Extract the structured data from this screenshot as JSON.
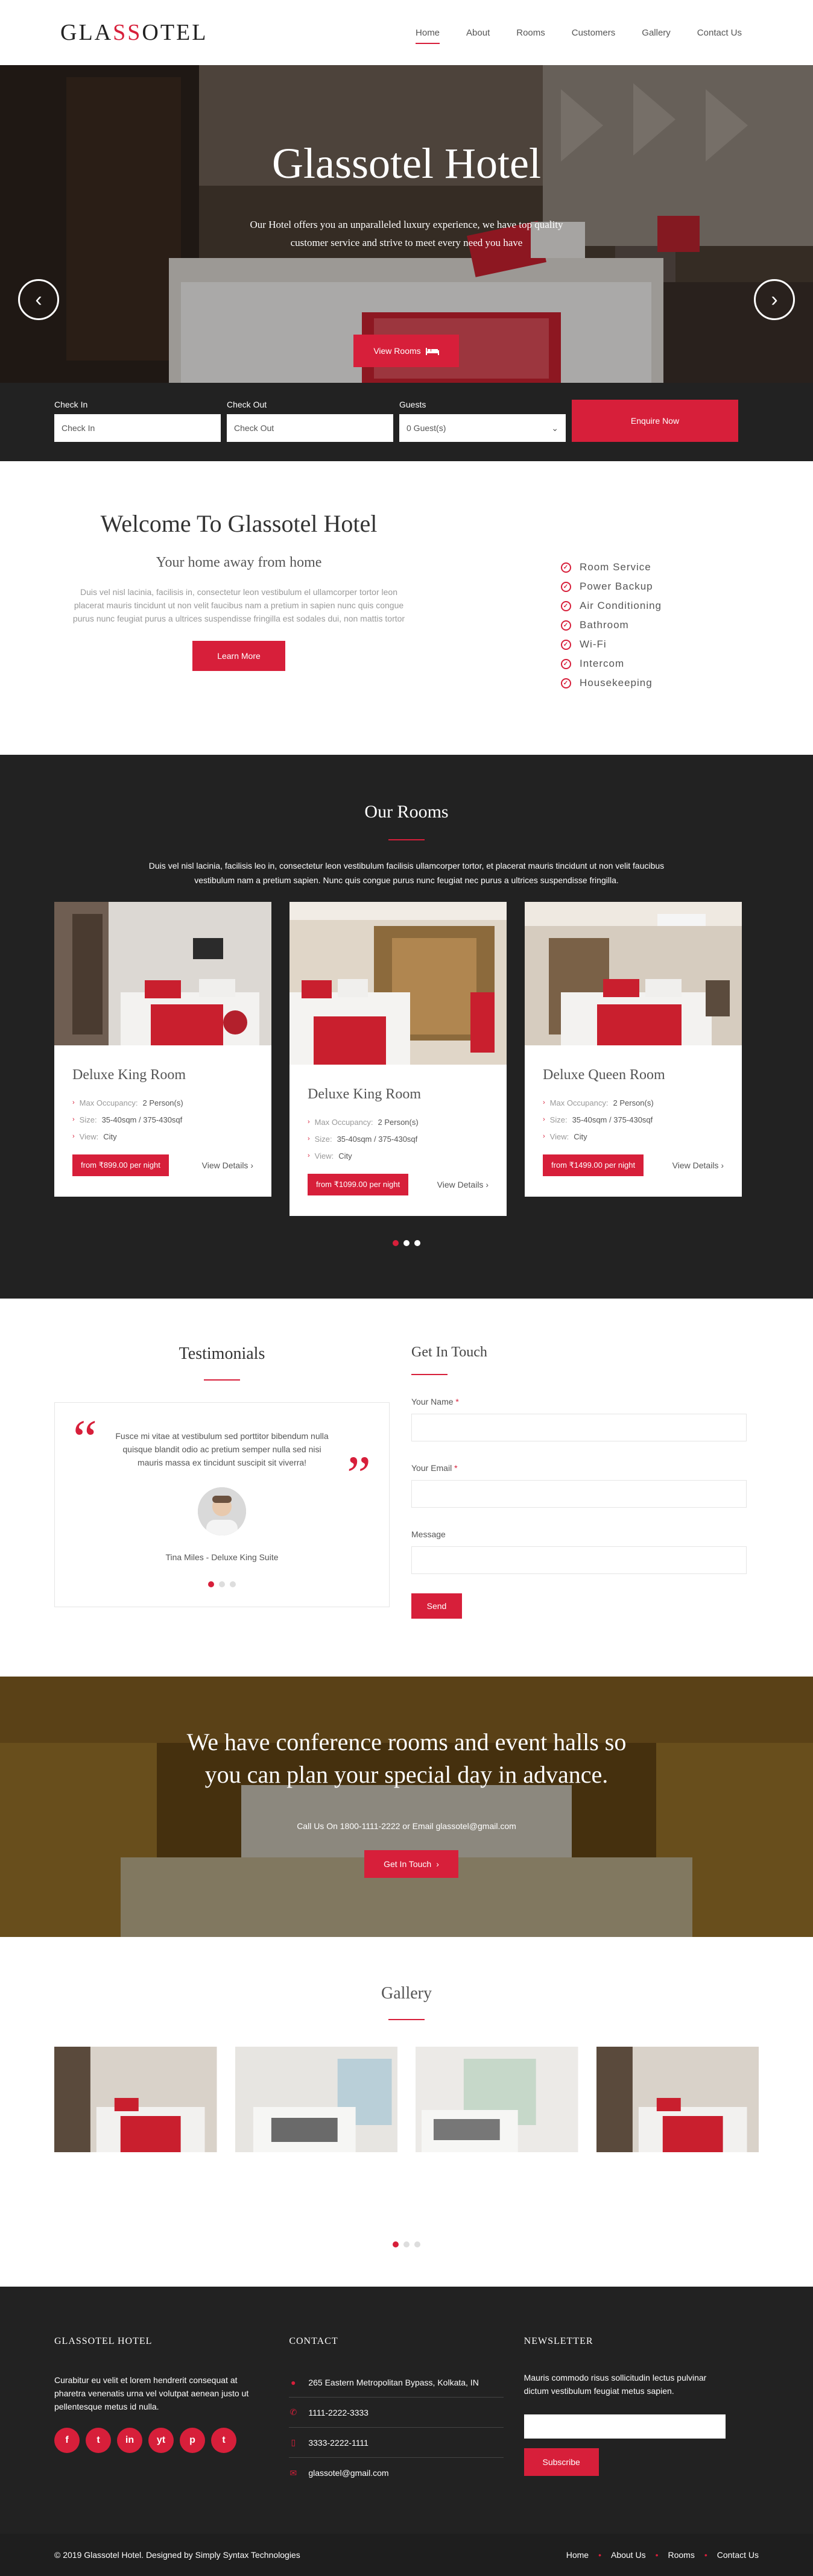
{
  "header": {
    "logo_left": "GLA",
    "logo_mid": "SS",
    "logo_right": "OTEL",
    "nav": [
      "Home",
      "About",
      "Rooms",
      "Customers",
      "Gallery",
      "Contact Us"
    ]
  },
  "hero": {
    "title": "Glassotel Hotel",
    "text": "Our Hotel offers you an unparalleled luxury experience, we have top quality customer service and strive to meet every need you have",
    "button": "View Rooms",
    "prev": "‹",
    "next": "›"
  },
  "booking": {
    "checkin_label": "Check In",
    "checkin_placeholder": "Check In",
    "checkout_label": "Check Out",
    "checkout_placeholder": "Check Out",
    "guests_label": "Guests",
    "guests_value": "0 Guest(s)",
    "button": "Enquire Now"
  },
  "welcome": {
    "title": "Welcome To Glassotel Hotel",
    "subtitle": "Your home away from home",
    "text": "Duis vel nisl lacinia, facilisis in, consectetur leon vestibulum el ullamcorper tortor leon placerat mauris tincidunt ut non velit faucibus nam a pretium in sapien nunc quis congue purus nunc feugiat purus a ultrices suspendisse fringilla est sodales dui, non mattis tortor",
    "button": "Learn More",
    "amenities": [
      "Room Service",
      "Power Backup",
      "Air Conditioning",
      "Bathroom",
      "Wi-Fi",
      "Intercom",
      "Housekeeping"
    ]
  },
  "rooms": {
    "title": "Our Rooms",
    "intro": "Duis vel nisl lacinia, facilisis leo in, consectetur leon vestibulum facilisis ullamcorper tortor, et placerat mauris tincidunt ut non velit faucibus vestibulum nam a pretium sapien. Nunc quis congue purus nunc feugiat nec purus a ultrices suspendisse fringilla.",
    "max_label": "Max Occupancy:",
    "size_label": "Size:",
    "view_label": "View:",
    "details": "View Details",
    "cards": [
      {
        "name": "Deluxe King Room",
        "occupancy": "2 Person(s)",
        "size": "35-40sqm / 375-430sqf",
        "view": "City",
        "price": "from ₹899.00 per night"
      },
      {
        "name": "Deluxe King Room",
        "occupancy": "2 Person(s)",
        "size": "35-40sqm / 375-430sqf",
        "view": "City",
        "price": "from ₹1099.00 per night"
      },
      {
        "name": "Deluxe Queen Room",
        "occupancy": "2 Person(s)",
        "size": "35-40sqm / 375-430sqf",
        "view": "City",
        "price": "from ₹1499.00 per night"
      }
    ]
  },
  "testimonials": {
    "title": "Testimonials",
    "quote": "Fusce mi vitae at vestibulum sed porttitor bibendum nulla quisque blandit odio ac pretium semper nulla sed nisi mauris massa ex tincidunt suscipit sit viverra!",
    "author": "Tina Miles - Deluxe King Suite"
  },
  "contact_form": {
    "title": "Get In Touch",
    "name_label": "Your Name",
    "email_label": "Your Email",
    "message_label": "Message",
    "required": "*",
    "button": "Send"
  },
  "conference": {
    "title": "We have conference rooms and event halls so you can plan your special day in advance.",
    "call": "Call Us On 1800-1111-2222 or Email glassotel@gmail.com",
    "button": "Get In Touch"
  },
  "gallery": {
    "title": "Gallery"
  },
  "footer": {
    "col1_title": "GLASSOTEL HOTEL",
    "col1_text": "Curabitur eu velit et lorem hendrerit consequat at pharetra venenatis urna vel volutpat aenean justo ut pellentesque metus id nulla.",
    "social": [
      "f",
      "t",
      "in",
      "yt",
      "p",
      "t"
    ],
    "col2_title": "CONTACT",
    "address": "265 Eastern Metropolitan Bypass, Kolkata, IN",
    "phone1": "1111-2222-3333",
    "phone2": "3333-2222-1111",
    "email": "glassotel@gmail.com",
    "col3_title": "NEWSLETTER",
    "col3_text": "Mauris commodo risus sollicitudin lectus pulvinar dictum vestibulum feugiat metus sapien.",
    "subscribe": "Subscribe",
    "copyright": "© 2019 Glassotel Hotel. Designed by Simply Syntax Technologies",
    "links": [
      "Home",
      "About Us",
      "Rooms",
      "Contact Us"
    ]
  },
  "colors": {
    "accent": "#d71f3a",
    "dark": "#222222"
  }
}
